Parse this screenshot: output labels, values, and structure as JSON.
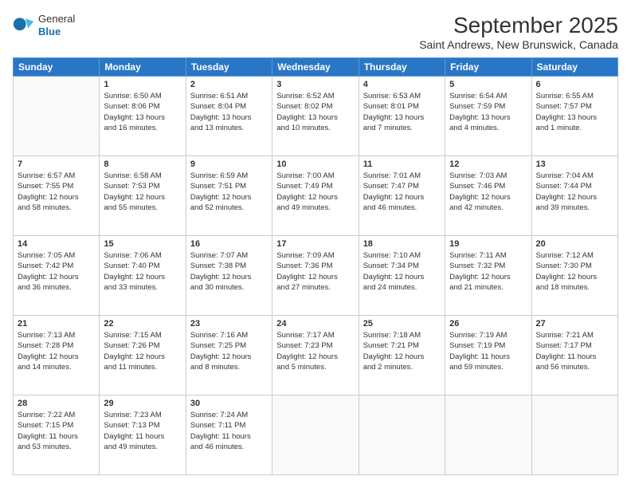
{
  "header": {
    "logo": {
      "general": "General",
      "blue": "Blue"
    },
    "title": "September 2025",
    "location": "Saint Andrews, New Brunswick, Canada"
  },
  "days_of_week": [
    "Sunday",
    "Monday",
    "Tuesday",
    "Wednesday",
    "Thursday",
    "Friday",
    "Saturday"
  ],
  "weeks": [
    [
      {
        "day": "",
        "data": ""
      },
      {
        "day": "1",
        "data": "Sunrise: 6:50 AM\nSunset: 8:06 PM\nDaylight: 13 hours\nand 16 minutes."
      },
      {
        "day": "2",
        "data": "Sunrise: 6:51 AM\nSunset: 8:04 PM\nDaylight: 13 hours\nand 13 minutes."
      },
      {
        "day": "3",
        "data": "Sunrise: 6:52 AM\nSunset: 8:02 PM\nDaylight: 13 hours\nand 10 minutes."
      },
      {
        "day": "4",
        "data": "Sunrise: 6:53 AM\nSunset: 8:01 PM\nDaylight: 13 hours\nand 7 minutes."
      },
      {
        "day": "5",
        "data": "Sunrise: 6:54 AM\nSunset: 7:59 PM\nDaylight: 13 hours\nand 4 minutes."
      },
      {
        "day": "6",
        "data": "Sunrise: 6:55 AM\nSunset: 7:57 PM\nDaylight: 13 hours\nand 1 minute."
      }
    ],
    [
      {
        "day": "7",
        "data": "Sunrise: 6:57 AM\nSunset: 7:55 PM\nDaylight: 12 hours\nand 58 minutes."
      },
      {
        "day": "8",
        "data": "Sunrise: 6:58 AM\nSunset: 7:53 PM\nDaylight: 12 hours\nand 55 minutes."
      },
      {
        "day": "9",
        "data": "Sunrise: 6:59 AM\nSunset: 7:51 PM\nDaylight: 12 hours\nand 52 minutes."
      },
      {
        "day": "10",
        "data": "Sunrise: 7:00 AM\nSunset: 7:49 PM\nDaylight: 12 hours\nand 49 minutes."
      },
      {
        "day": "11",
        "data": "Sunrise: 7:01 AM\nSunset: 7:47 PM\nDaylight: 12 hours\nand 46 minutes."
      },
      {
        "day": "12",
        "data": "Sunrise: 7:03 AM\nSunset: 7:46 PM\nDaylight: 12 hours\nand 42 minutes."
      },
      {
        "day": "13",
        "data": "Sunrise: 7:04 AM\nSunset: 7:44 PM\nDaylight: 12 hours\nand 39 minutes."
      }
    ],
    [
      {
        "day": "14",
        "data": "Sunrise: 7:05 AM\nSunset: 7:42 PM\nDaylight: 12 hours\nand 36 minutes."
      },
      {
        "day": "15",
        "data": "Sunrise: 7:06 AM\nSunset: 7:40 PM\nDaylight: 12 hours\nand 33 minutes."
      },
      {
        "day": "16",
        "data": "Sunrise: 7:07 AM\nSunset: 7:38 PM\nDaylight: 12 hours\nand 30 minutes."
      },
      {
        "day": "17",
        "data": "Sunrise: 7:09 AM\nSunset: 7:36 PM\nDaylight: 12 hours\nand 27 minutes."
      },
      {
        "day": "18",
        "data": "Sunrise: 7:10 AM\nSunset: 7:34 PM\nDaylight: 12 hours\nand 24 minutes."
      },
      {
        "day": "19",
        "data": "Sunrise: 7:11 AM\nSunset: 7:32 PM\nDaylight: 12 hours\nand 21 minutes."
      },
      {
        "day": "20",
        "data": "Sunrise: 7:12 AM\nSunset: 7:30 PM\nDaylight: 12 hours\nand 18 minutes."
      }
    ],
    [
      {
        "day": "21",
        "data": "Sunrise: 7:13 AM\nSunset: 7:28 PM\nDaylight: 12 hours\nand 14 minutes."
      },
      {
        "day": "22",
        "data": "Sunrise: 7:15 AM\nSunset: 7:26 PM\nDaylight: 12 hours\nand 11 minutes."
      },
      {
        "day": "23",
        "data": "Sunrise: 7:16 AM\nSunset: 7:25 PM\nDaylight: 12 hours\nand 8 minutes."
      },
      {
        "day": "24",
        "data": "Sunrise: 7:17 AM\nSunset: 7:23 PM\nDaylight: 12 hours\nand 5 minutes."
      },
      {
        "day": "25",
        "data": "Sunrise: 7:18 AM\nSunset: 7:21 PM\nDaylight: 12 hours\nand 2 minutes."
      },
      {
        "day": "26",
        "data": "Sunrise: 7:19 AM\nSunset: 7:19 PM\nDaylight: 11 hours\nand 59 minutes."
      },
      {
        "day": "27",
        "data": "Sunrise: 7:21 AM\nSunset: 7:17 PM\nDaylight: 11 hours\nand 56 minutes."
      }
    ],
    [
      {
        "day": "28",
        "data": "Sunrise: 7:22 AM\nSunset: 7:15 PM\nDaylight: 11 hours\nand 53 minutes."
      },
      {
        "day": "29",
        "data": "Sunrise: 7:23 AM\nSunset: 7:13 PM\nDaylight: 11 hours\nand 49 minutes."
      },
      {
        "day": "30",
        "data": "Sunrise: 7:24 AM\nSunset: 7:11 PM\nDaylight: 11 hours\nand 46 minutes."
      },
      {
        "day": "",
        "data": ""
      },
      {
        "day": "",
        "data": ""
      },
      {
        "day": "",
        "data": ""
      },
      {
        "day": "",
        "data": ""
      }
    ]
  ]
}
